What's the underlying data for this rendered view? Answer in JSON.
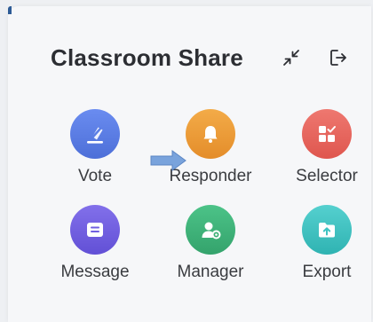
{
  "panel": {
    "title": "Classroom Share"
  },
  "header_actions": {
    "collapse_icon": "collapse-arrows-icon",
    "exit_icon": "exit-icon"
  },
  "tools": [
    {
      "label": "Vote",
      "icon": "vote-check-icon",
      "color": "#5b7ee5"
    },
    {
      "label": "Responder",
      "icon": "bell-icon",
      "color": "#eb9c36"
    },
    {
      "label": "Selector",
      "icon": "selector-grid-icon",
      "color": "#e8645c"
    },
    {
      "label": "Message",
      "icon": "message-icon",
      "color": "#7160e0"
    },
    {
      "label": "Manager",
      "icon": "manager-user-icon",
      "color": "#3fb37a"
    },
    {
      "label": "Export",
      "icon": "export-folder-icon",
      "color": "#3dc3c2"
    }
  ],
  "pointer": {
    "icon": "blue-arrow-icon",
    "color": "#6f9ad6"
  }
}
